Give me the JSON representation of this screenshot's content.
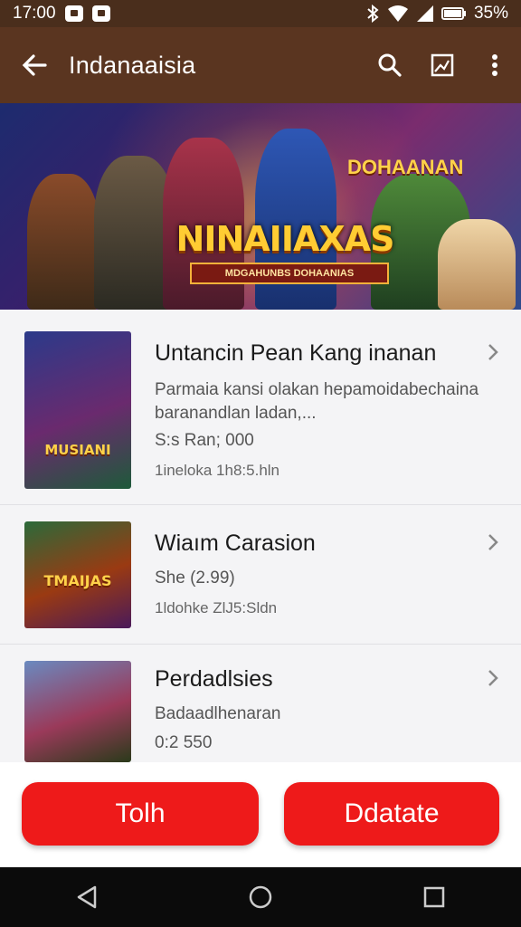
{
  "status": {
    "time": "17:00",
    "battery": "35%",
    "icons": [
      "notification-icon",
      "notification-icon",
      "bluetooth-icon",
      "wifi-icon",
      "signal-icon",
      "battery-icon"
    ]
  },
  "appbar": {
    "title": "Indanaaisia",
    "icons": [
      "back-arrow-icon",
      "search-icon",
      "image-icon",
      "more-vert-icon"
    ]
  },
  "banner": {
    "title": "NINAIIAXAS",
    "subtitle": "MDGAHUNBS DOHAANIAS",
    "tag": "DOHAANAN"
  },
  "list": {
    "items": [
      {
        "title": "Untancin Pean Kang  inanan",
        "desc": "Parmaia kansi olakan hepamoidabechaina baranandlan ladan,...",
        "price": "S:s Ran; 000",
        "meta": "1ineloka   1h8:5.hln",
        "thumb_text": "MUSIANI"
      },
      {
        "title": "Wiaım Carasion",
        "price": "She (2.99)",
        "meta": "1ldohke   ZlJ5:Sldn",
        "thumb_text": "TMAIJAS"
      },
      {
        "title": "Perdadlsies",
        "desc": "Badaadlhenaran",
        "price": "0:2 550",
        "thumb_text": ""
      }
    ]
  },
  "buttons": {
    "left": "Tolh",
    "right": "Ddatate"
  },
  "nav": {
    "icons": [
      "back-triangle-icon",
      "home-circle-icon",
      "recents-square-icon"
    ]
  },
  "colors": {
    "appbar": "#5a3520",
    "status": "#4a2e1c",
    "accent": "#ee1a1a"
  }
}
